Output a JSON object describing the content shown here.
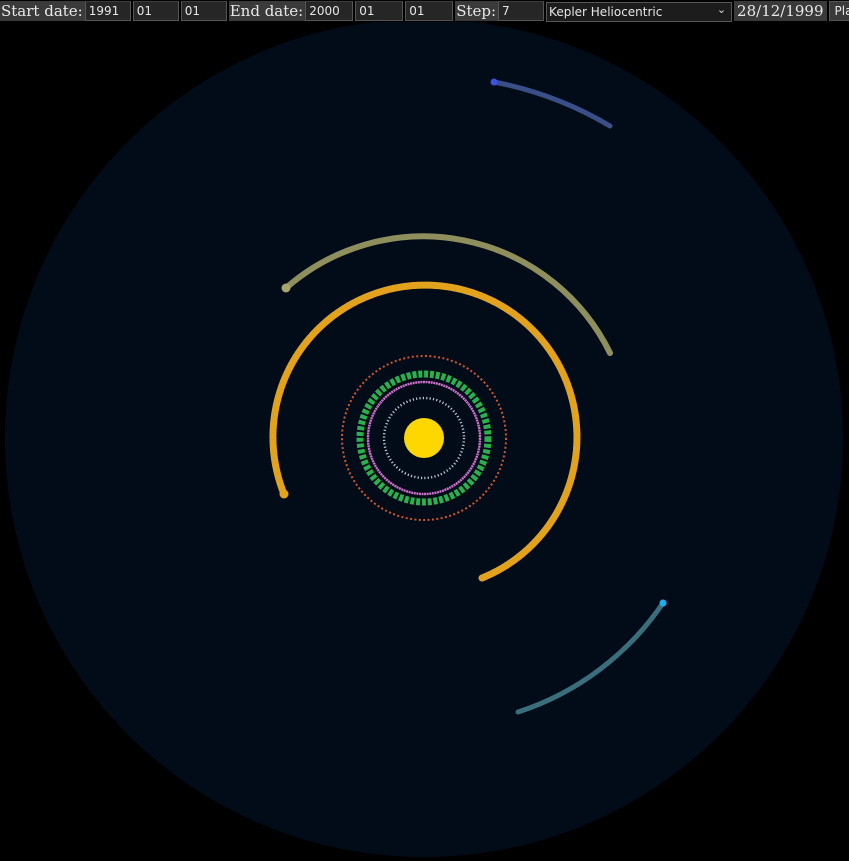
{
  "controls": {
    "start_label": "Start date:",
    "start_year": "1991",
    "start_month": "01",
    "start_day": "01",
    "end_label": "End date:",
    "end_year": "2000",
    "end_month": "01",
    "end_day": "01",
    "step_label": "Step:",
    "step_value": "7",
    "mode_selected": "Kepler Heliocentric",
    "current_date": "28/12/1999",
    "play_label": "Play"
  },
  "scene": {
    "background_color": "#000000",
    "space_color": "#020c18",
    "sun_color": "#ffd700"
  },
  "orbits": [
    {
      "name": "mercury",
      "color": "#b9c9d6",
      "ring": "full",
      "icon": "dotted-ring"
    },
    {
      "name": "venus",
      "color": "#d46fd0",
      "ring": "full",
      "icon": "dotted-ring"
    },
    {
      "name": "earth",
      "color": "#2ab04c",
      "ring": "full",
      "icon": "dotted-ring"
    },
    {
      "name": "mars",
      "color": "#d0552e",
      "ring": "full",
      "icon": "dotted-ring"
    },
    {
      "name": "jupiter",
      "color": "#e3a21b",
      "ring": "arc",
      "icon": "trail-arc"
    },
    {
      "name": "saturn",
      "color": "#a8a66a",
      "ring": "arc",
      "icon": "trail-arc"
    },
    {
      "name": "uranus",
      "color": "#3a6e7c",
      "ring": "arc",
      "icon": "trail-arc",
      "head_color": "#1ab0f0"
    },
    {
      "name": "neptune",
      "color": "#3a4e88",
      "ring": "arc",
      "icon": "trail-arc",
      "head_color": "#3b54e0"
    }
  ]
}
